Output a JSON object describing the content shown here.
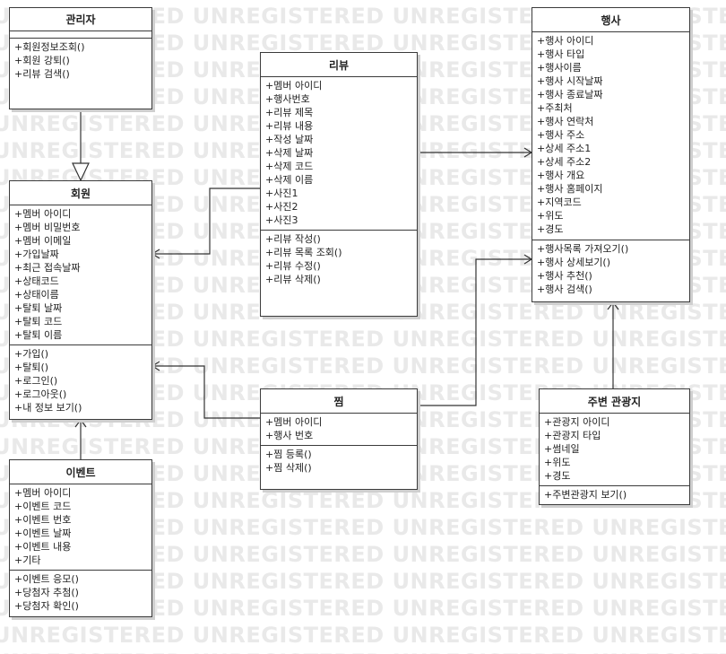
{
  "watermark_text": "UNREGISTERED",
  "classes": {
    "admin": {
      "name": "관리자",
      "attributes": [],
      "operations": [
        "+회원정보조회()",
        "+회원 강퇴()",
        "+리뷰 검색()"
      ]
    },
    "member": {
      "name": "회원",
      "attributes": [
        "+멤버 아이디",
        "+멤버 비밀번호",
        "+멤버 이메일",
        "+가입날짜",
        "+최근 접속날짜",
        "+상태코드",
        "+상태이름",
        "+탈퇴 날짜",
        "+탈퇴 코드",
        "+탈퇴 이름"
      ],
      "operations": [
        "+가입()",
        "+탈퇴()",
        "+로그인()",
        "+로그아웃()",
        "+내 정보 보기()"
      ]
    },
    "event": {
      "name": "이벤트",
      "attributes": [
        "+멤버 아이디",
        "+이벤트 코드",
        "+이벤트 번호",
        "+이벤트 날짜",
        "+이벤트 내용",
        "+기타"
      ],
      "operations": [
        "+이벤트 응모()",
        "+당첨자 추첨()",
        "+당첨자 확인()"
      ]
    },
    "review": {
      "name": "리뷰",
      "attributes": [
        "+멤버 아이디",
        "+행사번호",
        "+리뷰 제목",
        "+리뷰 내용",
        "+작성 날짜",
        "+삭제 날짜",
        "+삭제 코드",
        "+삭제 이름",
        "+사진1",
        "+사진2",
        "+사진3"
      ],
      "operations": [
        "+리뷰 작성()",
        "+리뷰 목록 조회()",
        "+리뷰 수정()",
        "+리뷰 삭제()"
      ]
    },
    "bookmark": {
      "name": "찜",
      "attributes": [
        "+멤버 아이디",
        "+행사 번호"
      ],
      "operations": [
        "+찜 등록()",
        "+찜 삭제()"
      ]
    },
    "festival": {
      "name": "행사",
      "attributes": [
        "+행사 아이디",
        "+행사 타입",
        "+행사이름",
        "+행사 시작날짜",
        "+행사 종료날짜",
        "+주최처",
        "+행사 연락처",
        "+행사 주소",
        "+상세 주소1",
        "+상세 주소2",
        "+행사 개요",
        "+행사 홈페이지",
        "+지역코드",
        "+위도",
        "+경도"
      ],
      "operations": [
        "+행사목록 가져오기()",
        "+행사 상세보기()",
        "+행사 추천()",
        "+행사 검색()"
      ]
    },
    "attraction": {
      "name": "주변 관광지",
      "attributes": [
        "+관광지 아이디",
        "+관광지 타입",
        "+썸네일",
        "+위도",
        "+경도"
      ],
      "operations": [
        "+주변관광지 보기()"
      ]
    }
  },
  "relations": [
    {
      "from": "admin",
      "to": "member",
      "type": "generalization"
    },
    {
      "from": "event",
      "to": "member",
      "type": "association"
    },
    {
      "from": "review",
      "to": "member",
      "type": "association"
    },
    {
      "from": "review",
      "to": "festival",
      "type": "association"
    },
    {
      "from": "bookmark",
      "to": "member",
      "type": "association"
    },
    {
      "from": "bookmark",
      "to": "festival",
      "type": "association"
    },
    {
      "from": "attraction",
      "to": "festival",
      "type": "association"
    }
  ]
}
